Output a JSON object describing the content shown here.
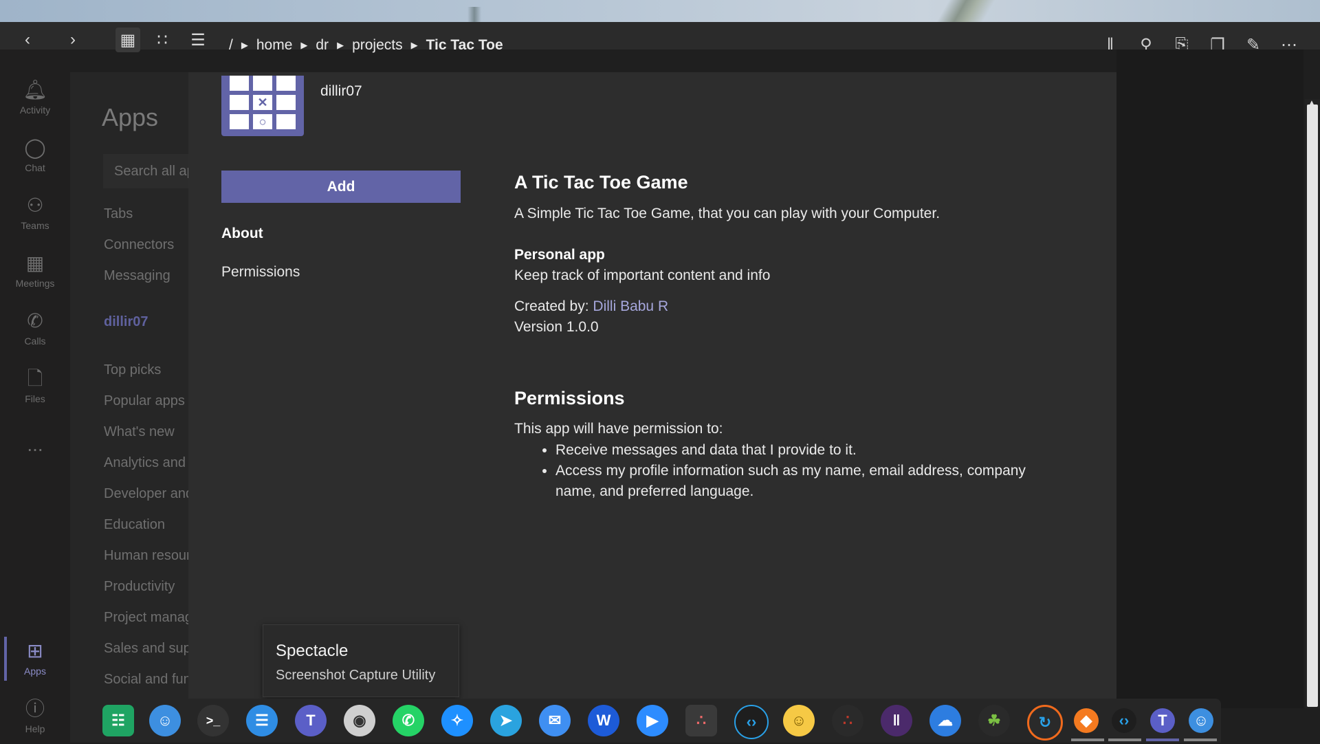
{
  "file_manager": {
    "breadcrumb": {
      "root": "/",
      "items": [
        "home",
        "dr",
        "projects"
      ],
      "current": "Tic Tac Toe"
    }
  },
  "rail": {
    "items": [
      {
        "label": "Activity",
        "icon": "bell-icon"
      },
      {
        "label": "Chat",
        "icon": "chat-icon"
      },
      {
        "label": "Teams",
        "icon": "teams-icon"
      },
      {
        "label": "Meetings",
        "icon": "calendar-icon"
      },
      {
        "label": "Calls",
        "icon": "phone-icon"
      },
      {
        "label": "Files",
        "icon": "file-icon"
      },
      {
        "label": "...",
        "icon": "more-icon"
      },
      {
        "label": "Apps",
        "icon": "apps-icon"
      },
      {
        "label": "Help",
        "icon": "help-icon"
      }
    ]
  },
  "apps_pane": {
    "title": "Apps",
    "search_placeholder": "Search all apps",
    "categories_top": [
      "Tabs",
      "Connectors",
      "Messaging"
    ],
    "org": "dillir07",
    "categories": [
      "Top picks",
      "Popular apps",
      "What's new",
      "Analytics and BI",
      "Developer and IT",
      "Education",
      "Human resources",
      "Productivity",
      "Project management",
      "Sales and support",
      "Social and fun"
    ]
  },
  "dialog": {
    "publisher": "dillir07",
    "add_label": "Add",
    "nav_about": "About",
    "nav_permissions": "Permissions",
    "app_title": "A Tic Tac Toe Game",
    "description": "A Simple Tic Tac Toe Game, that you can play with your Computer.",
    "personal_app_heading": "Personal app",
    "personal_app_desc": "Keep track of important content and info",
    "created_by_label": "Created by: ",
    "created_by_name": "Dilli Babu R",
    "version": "Version 1.0.0",
    "permissions_heading": "Permissions",
    "permissions_intro": "This app will have permission to:",
    "permissions": [
      "Receive messages and data that I provide to it.",
      "Access my profile information such as my name, email address, company name, and preferred language."
    ]
  },
  "tooltip": {
    "title": "Spectacle",
    "subtitle": "Screenshot Capture Utility"
  },
  "colors": {
    "accent": "#6264a7",
    "link": "#a6a7dc"
  }
}
